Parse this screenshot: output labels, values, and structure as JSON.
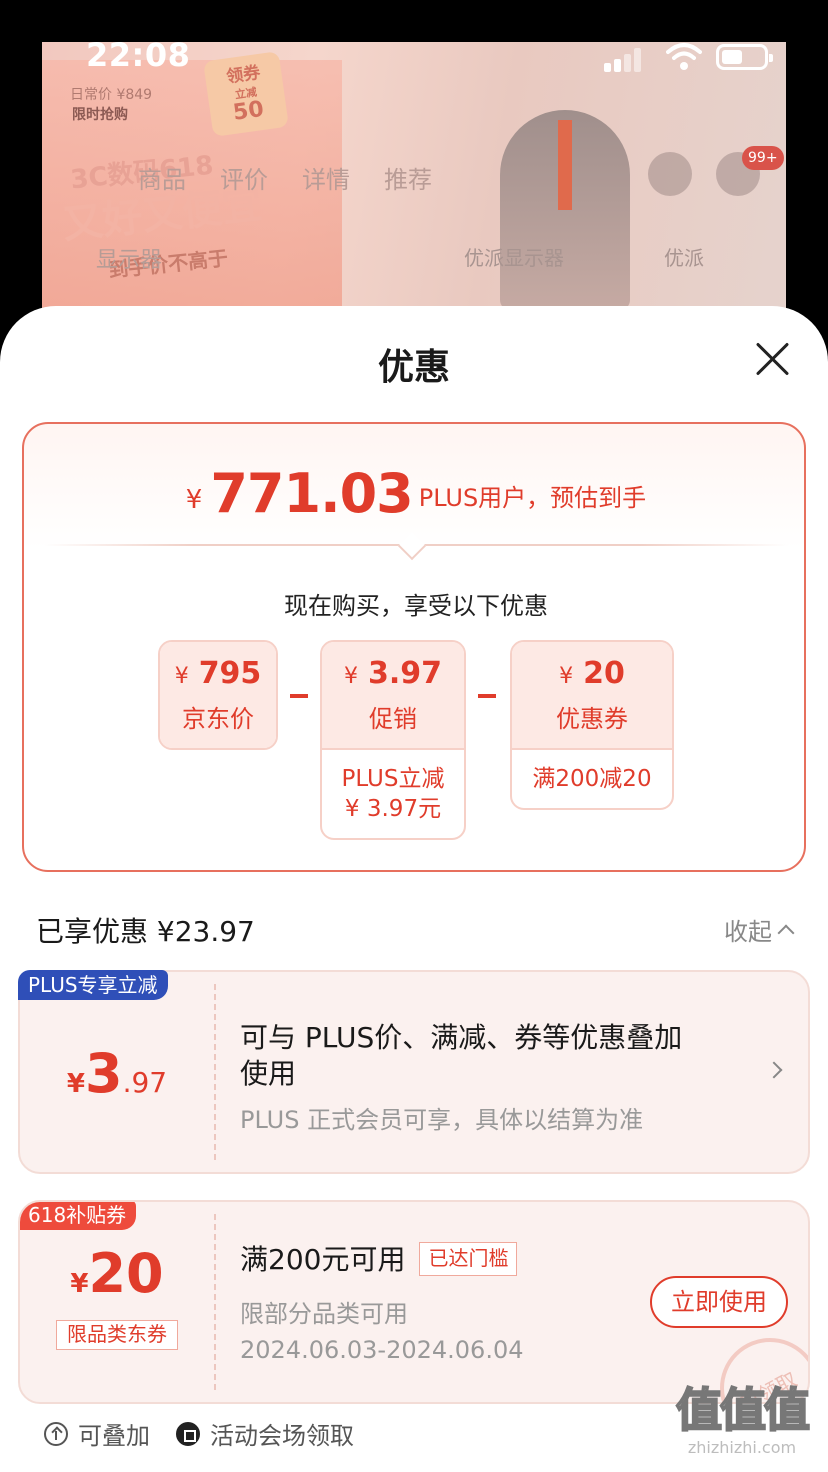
{
  "status_bar": {
    "time": "22:08"
  },
  "background": {
    "daily_price": "日常价 ¥849",
    "limited": "限时抢购",
    "coupon": {
      "title": "领券",
      "sub": "立减",
      "amount": "50"
    },
    "slogan_small": "3C数码618",
    "slogan_big": "又好又便宜",
    "slogan_note": "到手价不高于",
    "tabs": [
      "商品",
      "评价",
      "详情",
      "推荐"
    ],
    "radio_label": "显示器",
    "monitor_label": "优派显示器",
    "monitor_label2": "优派",
    "cart_badge": "99+"
  },
  "sheet": {
    "title": "优惠",
    "summary": {
      "currency": "¥",
      "final_price": "771.03",
      "final_desc": "PLUS用户，预估到手",
      "buy_now_text": "现在购买，享受以下优惠",
      "chips": [
        {
          "currency": "¥",
          "value": "795",
          "label": "京东价"
        },
        {
          "currency": "¥",
          "value": "3.97",
          "label": "促销",
          "sub_line1": "PLUS立减",
          "sub_line2": "¥ 3.97元"
        },
        {
          "currency": "¥",
          "value": "20",
          "label": "优惠券",
          "sub_line1": "满200减20"
        }
      ]
    },
    "enjoyed": {
      "label": "已享优惠 ¥23.97",
      "collapse": "收起"
    },
    "discounts": [
      {
        "tag": "PLUS专享立减",
        "currency": "¥",
        "int": "3",
        "dec": ".97",
        "title_line1": "可与 PLUS价、满减、券等优惠叠加",
        "title_line2": "使用",
        "subtitle": "PLUS 正式会员可享，具体以结算为准"
      },
      {
        "tag": "618补贴券",
        "currency": "¥",
        "int": "20",
        "limit_tag": "限品类东券",
        "title": "满200元可用",
        "reached": "已达门槛",
        "subtitle": "限部分品类可用",
        "date_range": "2024.06.03-2024.06.04",
        "button": "立即使用",
        "stamp": "已领取"
      }
    ],
    "footer": {
      "stackable": "可叠加",
      "source": "活动会场领取"
    }
  },
  "watermark": {
    "big": "值值值",
    "small": "zhizhizhi.com"
  },
  "colors": {
    "accent": "#e03c2b",
    "plus_blue": "#2f4fb8",
    "tag_red": "#ee4b3c"
  }
}
